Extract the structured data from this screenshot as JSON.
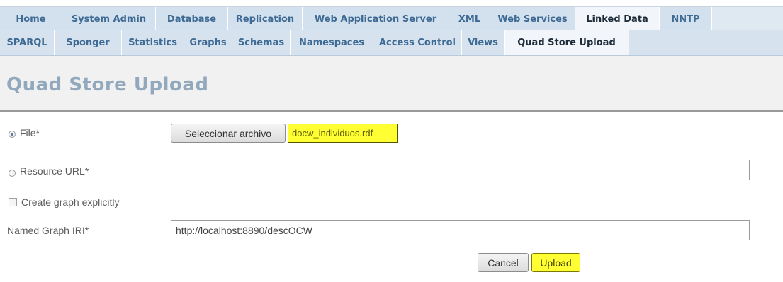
{
  "nav": {
    "primary_tabs": [
      {
        "label": "Home",
        "active": false
      },
      {
        "label": "System Admin",
        "active": false
      },
      {
        "label": "Database",
        "active": false
      },
      {
        "label": "Replication",
        "active": false
      },
      {
        "label": "Web Application Server",
        "active": false
      },
      {
        "label": "XML",
        "active": false
      },
      {
        "label": "Web Services",
        "active": false
      },
      {
        "label": "Linked Data",
        "active": true
      },
      {
        "label": "NNTP",
        "active": false
      }
    ],
    "secondary_tabs": [
      {
        "label": "SPARQL",
        "active": false
      },
      {
        "label": "Sponger",
        "active": false
      },
      {
        "label": "Statistics",
        "active": false
      },
      {
        "label": "Graphs",
        "active": false
      },
      {
        "label": "Schemas",
        "active": false
      },
      {
        "label": "Namespaces",
        "active": false
      },
      {
        "label": "Access Control",
        "active": false
      },
      {
        "label": "Views",
        "active": false
      },
      {
        "label": "Quad Store Upload",
        "active": true
      }
    ]
  },
  "page": {
    "title": "Quad Store Upload"
  },
  "form": {
    "file": {
      "label": "File*",
      "selected": true,
      "button_label": "Seleccionar archivo",
      "filename": "docw_individuos.rdf"
    },
    "resource_url": {
      "label": "Resource URL*",
      "selected": false,
      "value": ""
    },
    "create_graph": {
      "label": "Create graph explicitly",
      "checked": false
    },
    "named_graph": {
      "label": "Named Graph IRI*",
      "value": "http://localhost:8890/descOCW"
    },
    "cancel_label": "Cancel",
    "upload_label": "Upload"
  },
  "colors": {
    "tab_text": "#3e6a94",
    "title_text": "#92a9bd",
    "highlight": "#ffff33"
  }
}
